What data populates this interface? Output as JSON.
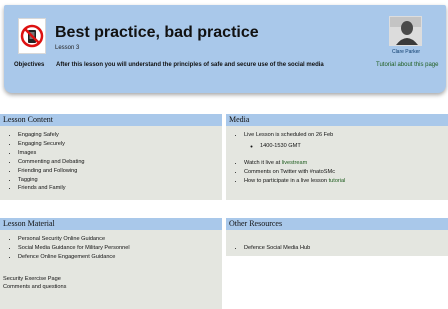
{
  "header": {
    "title": "Best practice, bad practice",
    "subtitle": "Lesson 3",
    "author": "Clare Parker",
    "objectives_label": "Objectives",
    "objectives_text": "After this lesson you will understand the principles of safe and secure use of the social media",
    "tutorial_link": "Tutorial about this page"
  },
  "lesson_content": {
    "heading": "Lesson Content",
    "items": [
      "Engaging Safely",
      "Engaging Securely",
      "Images",
      "Commenting and Debating",
      "Friending and Following",
      "Tagging",
      "Friends and Family"
    ]
  },
  "media": {
    "heading": "Media",
    "live": "Live Lesson is scheduled on 26 Feb",
    "time": "1400-1530 GMT",
    "watch_prefix": "Watch it live at",
    "watch_link": "livestream",
    "twitter": "Comments on Twitter with #natoSMc",
    "howto_prefix": "How to participate in a live lesson",
    "howto_link": "tutorial"
  },
  "lesson_material": {
    "heading": "Lesson Material",
    "items": [
      "Personal Security Online Guidance",
      "Social Media Guidance for Military Personnel",
      "Defence Online Engagement Guidance"
    ],
    "exercise": "Security Exercise Page",
    "comments": "Comments and questions"
  },
  "other_resources": {
    "heading": "Other Resources",
    "items": [
      "Defence Social Media Hub"
    ]
  },
  "colors": {
    "header_bg": "#a9c8ea",
    "panel_bg": "#e4e6e0",
    "link": "#1d5c1d"
  }
}
